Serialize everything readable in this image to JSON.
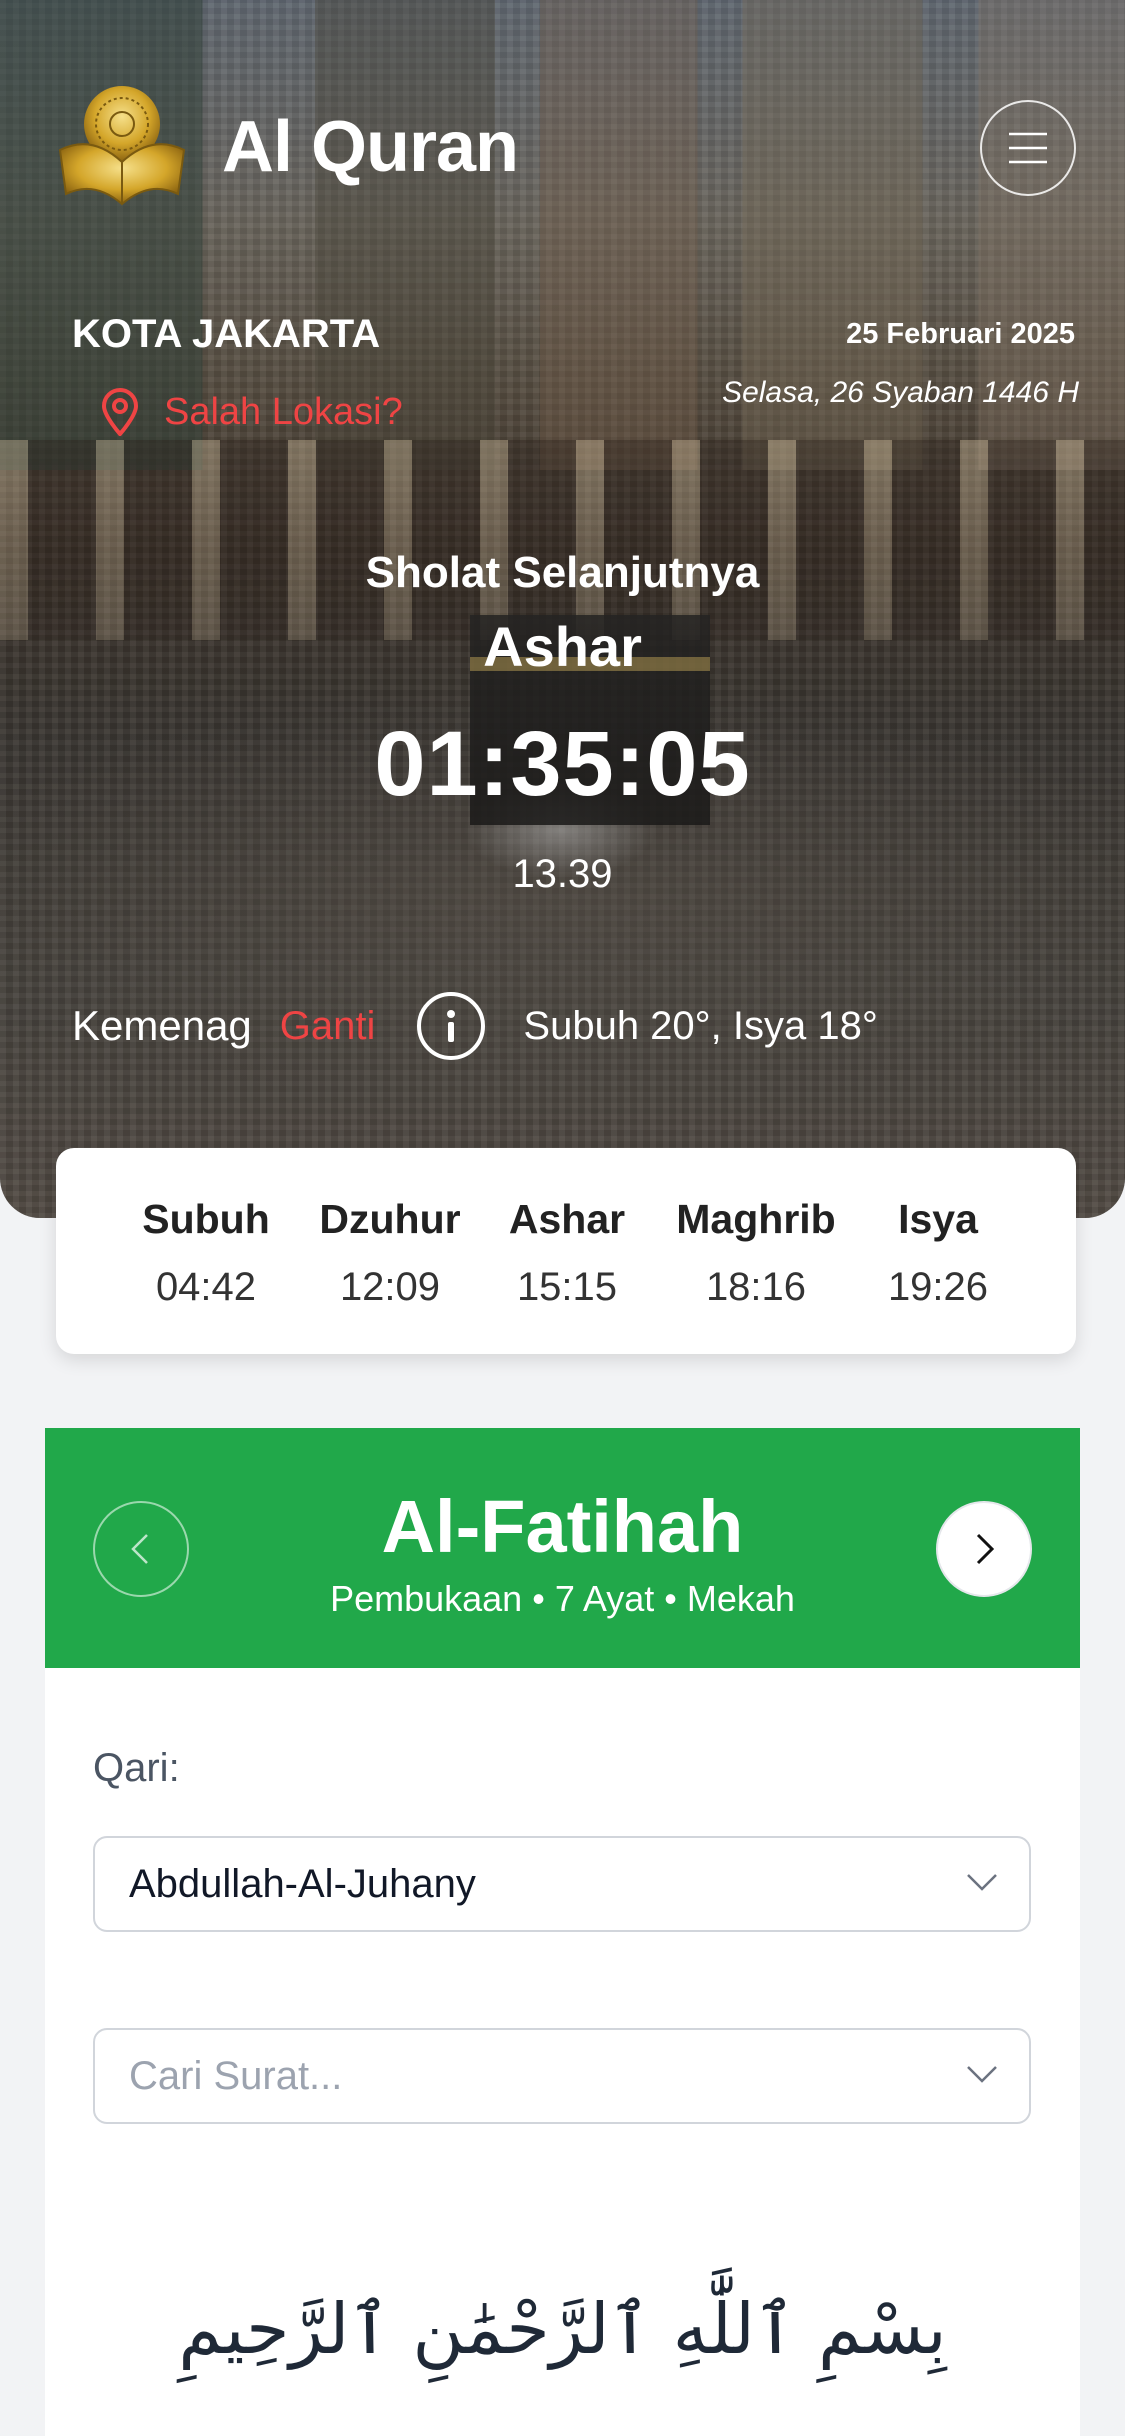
{
  "header": {
    "app_title": "Al Quran",
    "logo_icon": "quran-book-icon",
    "menu_icon": "hamburger-menu-icon"
  },
  "location": {
    "city": "KOTA JAKARTA",
    "wrong_location_label": "Salah Lokasi?",
    "pin_icon": "location-pin-icon"
  },
  "dates": {
    "gregorian": "25 Februari 2025",
    "hijri": "Selasa, 26 Syaban 1446 H"
  },
  "next_prayer": {
    "label": "Sholat Selanjutnya",
    "name": "Ashar",
    "countdown": "01:35:05",
    "time": "13.39"
  },
  "method": {
    "name": "Kemenag",
    "change_label": "Ganti",
    "info_icon": "info-icon",
    "angles": "Subuh 20°, Isya 18°"
  },
  "prayer_times": [
    {
      "name": "Subuh",
      "time": "04:42"
    },
    {
      "name": "Dzuhur",
      "time": "12:09"
    },
    {
      "name": "Ashar",
      "time": "15:15"
    },
    {
      "name": "Maghrib",
      "time": "18:16"
    },
    {
      "name": "Isya",
      "time": "19:26"
    }
  ],
  "surah": {
    "name": "Al-Fatihah",
    "meta": "Pembukaan • 7 Ayat • Mekah",
    "prev_icon": "chevron-left-icon",
    "next_icon": "chevron-right-icon"
  },
  "qari": {
    "label": "Qari:",
    "selected": "Abdullah-Al-Juhany"
  },
  "search": {
    "placeholder": "Cari Surat..."
  },
  "basmala": "بِسْمِ ٱللَّٰهِ ٱلرَّحْمَٰنِ ٱلرَّحِيمِ",
  "colors": {
    "accent_green": "#21a84a",
    "alert_red": "#ef4444"
  }
}
